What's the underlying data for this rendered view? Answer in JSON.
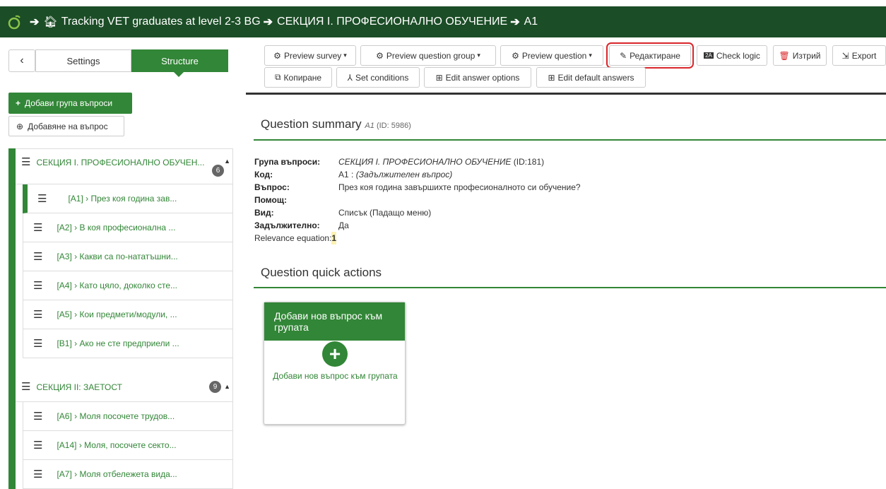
{
  "topbar": {
    "project": "Tracking VET graduates at level 2-3 BG",
    "section": "СЕКЦИЯ I. ПРОФЕСИОНАЛНО ОБУЧЕНИЕ",
    "question": "A1"
  },
  "sidebar": {
    "back_label": "‹",
    "tab_settings": "Settings",
    "tab_structure": "Structure",
    "add_group": "Добави група въпроси",
    "add_question": "Добавяне на въпрос",
    "groups": [
      {
        "title": "СЕКЦИЯ I. ПРОФЕСИОНАЛНО ОБУЧЕН...",
        "count": "6",
        "items": [
          {
            "code": "[A1]",
            "text": "През коя година зав..."
          },
          {
            "code": "[A2]",
            "text": "В коя професионална ..."
          },
          {
            "code": "[A3]",
            "text": "Какви са по-нататъшни..."
          },
          {
            "code": "[A4]",
            "text": "Като цяло, доколко сте..."
          },
          {
            "code": "[A5]",
            "text": "Кои предмети/модули, ..."
          },
          {
            "code": "[B1]",
            "text": "Ако не сте предприели ..."
          }
        ]
      },
      {
        "title": "СЕКЦИЯ II: ЗАЕТОСТ",
        "count": "9",
        "items": [
          {
            "code": "[A6]",
            "text": "Моля посочете трудов..."
          },
          {
            "code": "[A14]",
            "text": "Моля, посочете секто..."
          },
          {
            "code": "[A7]",
            "text": "Моля отбележета вида..."
          }
        ]
      }
    ]
  },
  "toolbar": {
    "preview_survey": "Preview survey",
    "preview_group": "Preview question group",
    "preview_question": "Preview question",
    "edit": "Редактиране",
    "check_logic": "Check logic",
    "delete": "Изтрий",
    "export": "Export",
    "copy": "Копиране",
    "set_conditions": "Set conditions",
    "edit_answer_options": "Edit answer options",
    "edit_default_answers": "Edit default answers"
  },
  "summary": {
    "title": "Question summary",
    "code_ref": "A1",
    "id_ref": "(ID: 5986)",
    "rows": {
      "group_label": "Група въпроси:",
      "group_value": "СЕКЦИЯ I. ПРОФЕСИОНАЛНО ОБУЧЕНИЕ",
      "group_id": "(ID:181)",
      "code_label": "Код:",
      "code_value": "A1 :",
      "code_mandatory": "(Задължителен въпрос)",
      "question_label": "Въпрос:",
      "question_value": "През коя година завършихте професионалното си обучение?",
      "help_label": "Помощ:",
      "type_label": "Вид:",
      "type_value": "Списък (Падащо меню)",
      "mandatory_label": "Задължително:",
      "mandatory_value": "Да",
      "relevance_label": "Relevance equation:",
      "relevance_value": "1"
    }
  },
  "quick_actions": {
    "title": "Question quick actions",
    "card_title": "Добави нов въпрос към групата",
    "card_label": "Добави нов въпрос към групата"
  },
  "colors": {
    "brand_dark": "#1b4d26",
    "brand_green": "#328637",
    "danger": "#d9262b"
  }
}
